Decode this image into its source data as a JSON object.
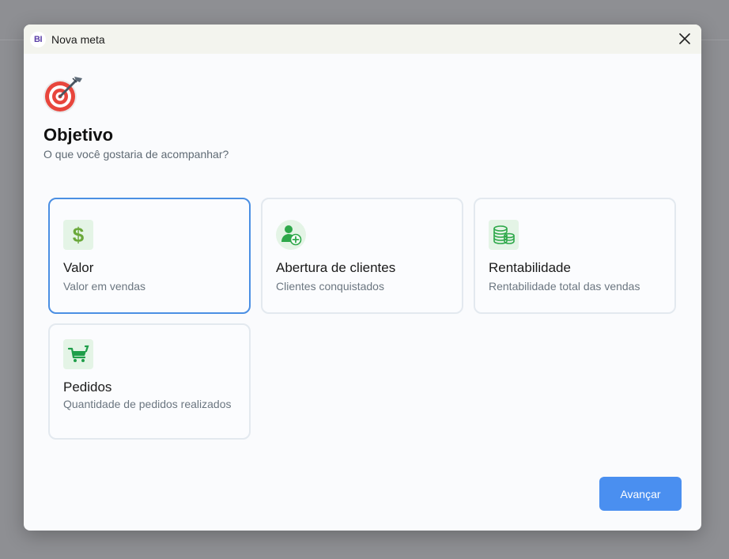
{
  "window": {
    "logo_text": "BI",
    "title": "Nova meta"
  },
  "header": {
    "icon": "target-icon",
    "title": "Objetivo",
    "subtitle": "O que você gostaria de acompanhar?"
  },
  "options": [
    {
      "title": "Valor",
      "description": "Valor em vendas",
      "icon": "dollar-icon",
      "selected": true
    },
    {
      "title": "Abertura de clientes",
      "description": "Clientes conquistados",
      "icon": "add-user-icon",
      "selected": false
    },
    {
      "title": "Rentabilidade",
      "description": "Rentabilidade total das vendas",
      "icon": "coins-icon",
      "selected": false
    },
    {
      "title": "Pedidos",
      "description": "Quantidade de pedidos realizados",
      "icon": "cart-icon",
      "selected": false
    }
  ],
  "footer": {
    "next_label": "Avançar"
  },
  "colors": {
    "accent": "#4a8ff0",
    "selected_border": "#4b8fe3",
    "icon_green": "#2ea84a",
    "icon_bg": "#e4f4e6"
  }
}
